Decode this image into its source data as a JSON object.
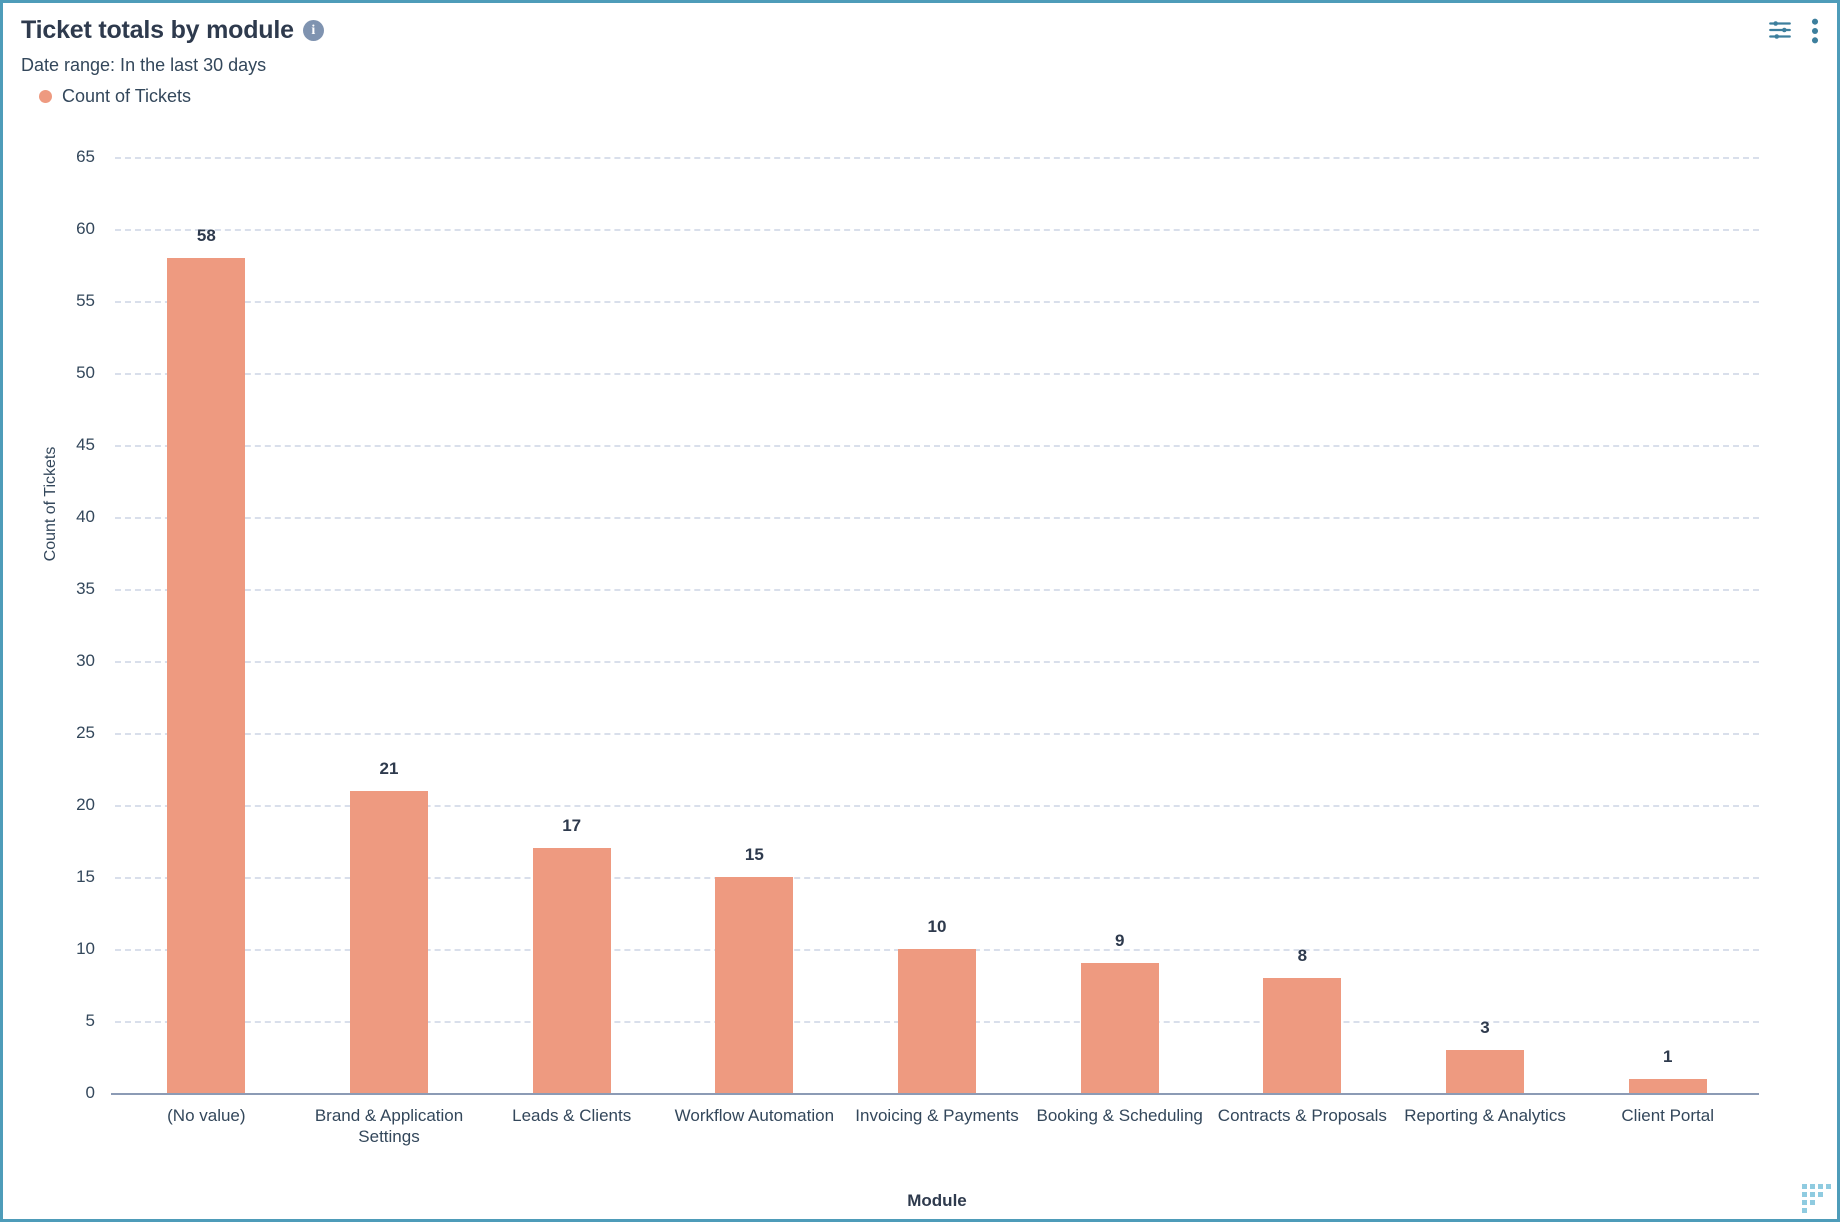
{
  "card": {
    "border_color": "#4e9cb9",
    "background": "#ffffff"
  },
  "header": {
    "title": "Ticket totals by module",
    "info_icon": "info-icon",
    "date_range": "Date range: In the last 30 days",
    "legend": [
      {
        "label": "Count of Tickets",
        "color": "#ee9a80"
      }
    ],
    "actions": [
      {
        "name": "filter-settings-icon",
        "label": "Filters"
      },
      {
        "name": "more-options-icon",
        "label": "More"
      }
    ],
    "action_color": "#3d7f9d"
  },
  "chart_data": {
    "type": "bar",
    "title": "Ticket totals by module",
    "subtitle": "Date range: In the last 30 days",
    "xlabel": "Module",
    "ylabel": "Count of Tickets",
    "ylim": [
      0,
      65
    ],
    "yticks": [
      0,
      5,
      10,
      15,
      20,
      25,
      30,
      35,
      40,
      45,
      50,
      55,
      60,
      65
    ],
    "grid": true,
    "legend": [
      "Count of Tickets"
    ],
    "legend_position": "top-left",
    "bar_color": "#ee9a80",
    "categories": [
      "(No value)",
      "Brand & Application Settings",
      "Leads & Clients",
      "Workflow Automation",
      "Invoicing & Payments",
      "Booking & Scheduling",
      "Contracts & Proposals",
      "Reporting & Analytics",
      "Client Portal"
    ],
    "series": [
      {
        "name": "Count of Tickets",
        "values": [
          58,
          21,
          17,
          15,
          10,
          9,
          8,
          3,
          1
        ]
      }
    ],
    "data_labels": [
      "58",
      "21",
      "17",
      "15",
      "10",
      "9",
      "8",
      "3",
      "1"
    ]
  },
  "resize_handle": {
    "name": "resize-handle",
    "color": "#8fcbe0"
  }
}
